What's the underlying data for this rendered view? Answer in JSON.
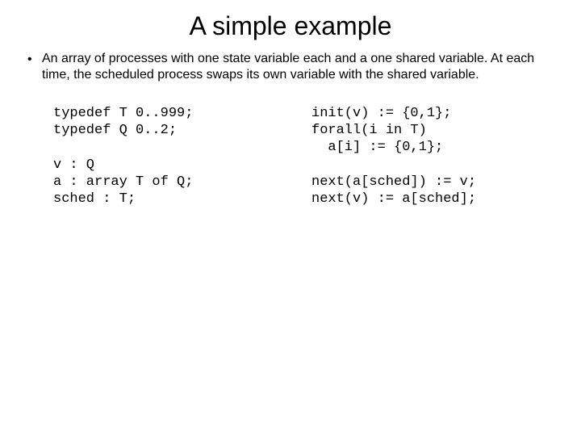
{
  "title": "A simple example",
  "bullet": {
    "marker": "•",
    "text": "An array of processes with one state variable each and a one shared variable. At each time, the scheduled process swaps its own variable with the shared variable."
  },
  "code_left": "typedef T 0..999;\ntypedef Q 0..2;\n\nv : Q\na : array T of Q;\nsched : T;",
  "code_right": "init(v) := {0,1};\nforall(i in T)\n  a[i] := {0,1};\n\nnext(a[sched]) := v;\nnext(v) := a[sched];"
}
